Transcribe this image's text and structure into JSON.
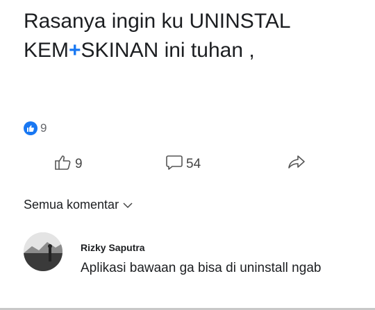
{
  "post": {
    "line1": "Rasanya ingin ku UNINSTAL",
    "line2_before": "KEM",
    "line2_cross": "+",
    "line2_after": "SKINAN ini tuhan ,"
  },
  "reactions": {
    "count": "9",
    "icon": "like-badge-icon",
    "accent": "#1877f2"
  },
  "actions": {
    "like_count": "9",
    "comment_count": "54",
    "share_icon": "share-arrow-icon"
  },
  "comments_sort": {
    "label": "Semua komentar"
  },
  "comment": {
    "author": "Rizky Saputra",
    "text": "Aplikasi bawaan ga bisa di uninstall ngab"
  }
}
